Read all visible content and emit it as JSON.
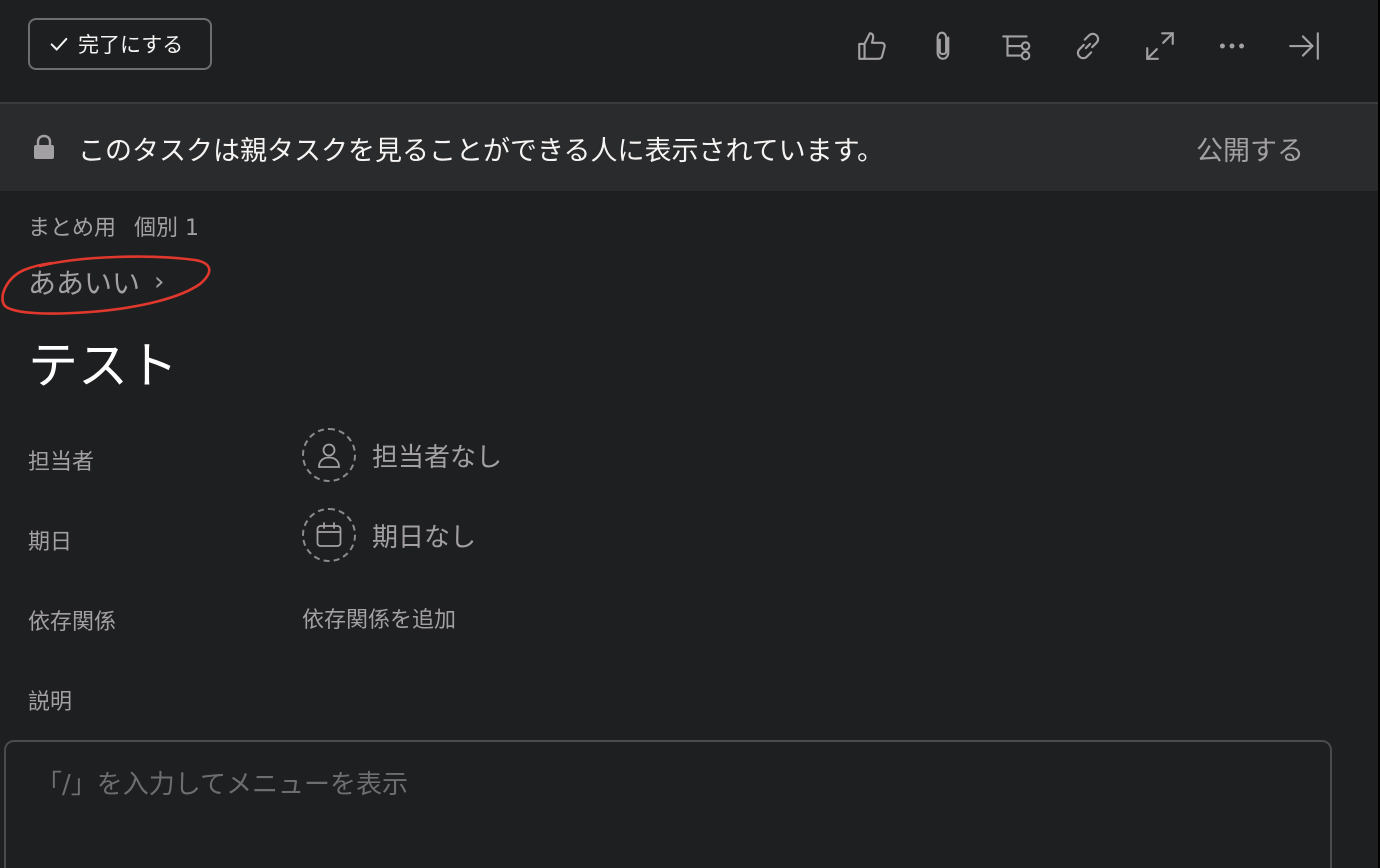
{
  "toolbar": {
    "complete_label": "完了にする",
    "icons": [
      "thumbs-up-icon",
      "paperclip-icon",
      "subtask-icon",
      "link-icon",
      "expand-icon",
      "more-icon",
      "close-panel-icon"
    ]
  },
  "banner": {
    "text": "このタスクは親タスクを見ることができる人に表示されています。",
    "action": "公開する"
  },
  "breadcrumb": {
    "project": "まとめ用",
    "section": "個別 1"
  },
  "parent_task": {
    "label": "ああいい",
    "chevron": "›"
  },
  "task": {
    "title": "テスト"
  },
  "fields": {
    "assignee_label": "担当者",
    "assignee_value": "担当者なし",
    "due_label": "期日",
    "due_value": "期日なし",
    "dependency_label": "依存関係",
    "dependency_value": "依存関係を追加",
    "description_label": "説明"
  },
  "description": {
    "placeholder": "「/」を入力してメニューを表示"
  },
  "colors": {
    "background": "#1e1f21",
    "banner": "#2a2b2d",
    "annotation": "#e0382c"
  }
}
